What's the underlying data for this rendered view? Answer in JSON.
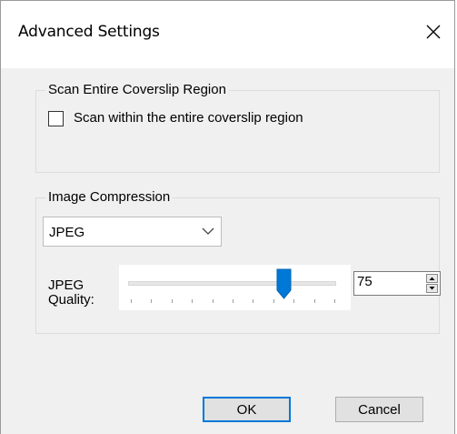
{
  "window": {
    "title": "Advanced Settings",
    "close_label": "✕"
  },
  "scan_group": {
    "legend": "Scan Entire Coverslip Region",
    "checkbox_label": "Scan within the entire coverslip region",
    "checked": false
  },
  "compression_group": {
    "legend": "Image Compression",
    "format_selected": "JPEG",
    "quality_label_line1": "JPEG",
    "quality_label_line2": "Quality:",
    "quality_value": "75",
    "quality_slider_fraction": 0.75
  },
  "buttons": {
    "ok": "OK",
    "cancel": "Cancel"
  },
  "colors": {
    "accent": "#0078d7",
    "window_bg": "#f0f0f0"
  }
}
